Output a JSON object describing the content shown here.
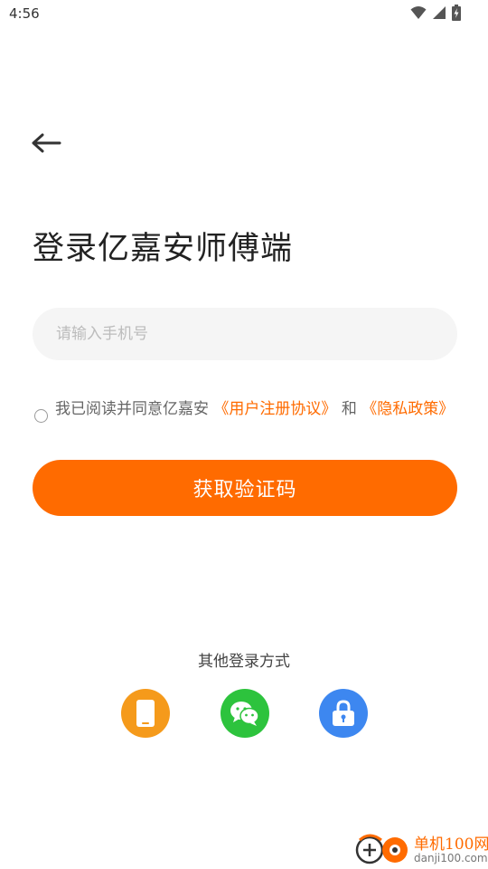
{
  "status_bar": {
    "time": "4:56",
    "icons": [
      "wifi-icon",
      "signal-icon",
      "battery-icon"
    ]
  },
  "header": {
    "back_icon": "arrow-left-icon",
    "title": "登录亿嘉安师傅端"
  },
  "form": {
    "phone_placeholder": "请输入手机号",
    "phone_value": "",
    "agreement_checked": false,
    "agreement_prefix": "我已阅读并同意亿嘉安",
    "user_agreement_link": "《用户注册协议》",
    "agreement_and": "和",
    "privacy_policy_link": "《隐私政策》",
    "submit_label": "获取验证码"
  },
  "other_login": {
    "title": "其他登录方式",
    "options": [
      {
        "icon": "phone-icon",
        "color": "#f59a1b"
      },
      {
        "icon": "wechat-icon",
        "color": "#2dc33d"
      },
      {
        "icon": "lock-icon",
        "color": "#3d87f0"
      }
    ]
  },
  "watermark": {
    "name": "单机100网",
    "domain": "danji100.com"
  },
  "colors": {
    "accent": "#ff6b00",
    "input_bg": "#f5f5f5",
    "placeholder": "#bcbcbc"
  }
}
